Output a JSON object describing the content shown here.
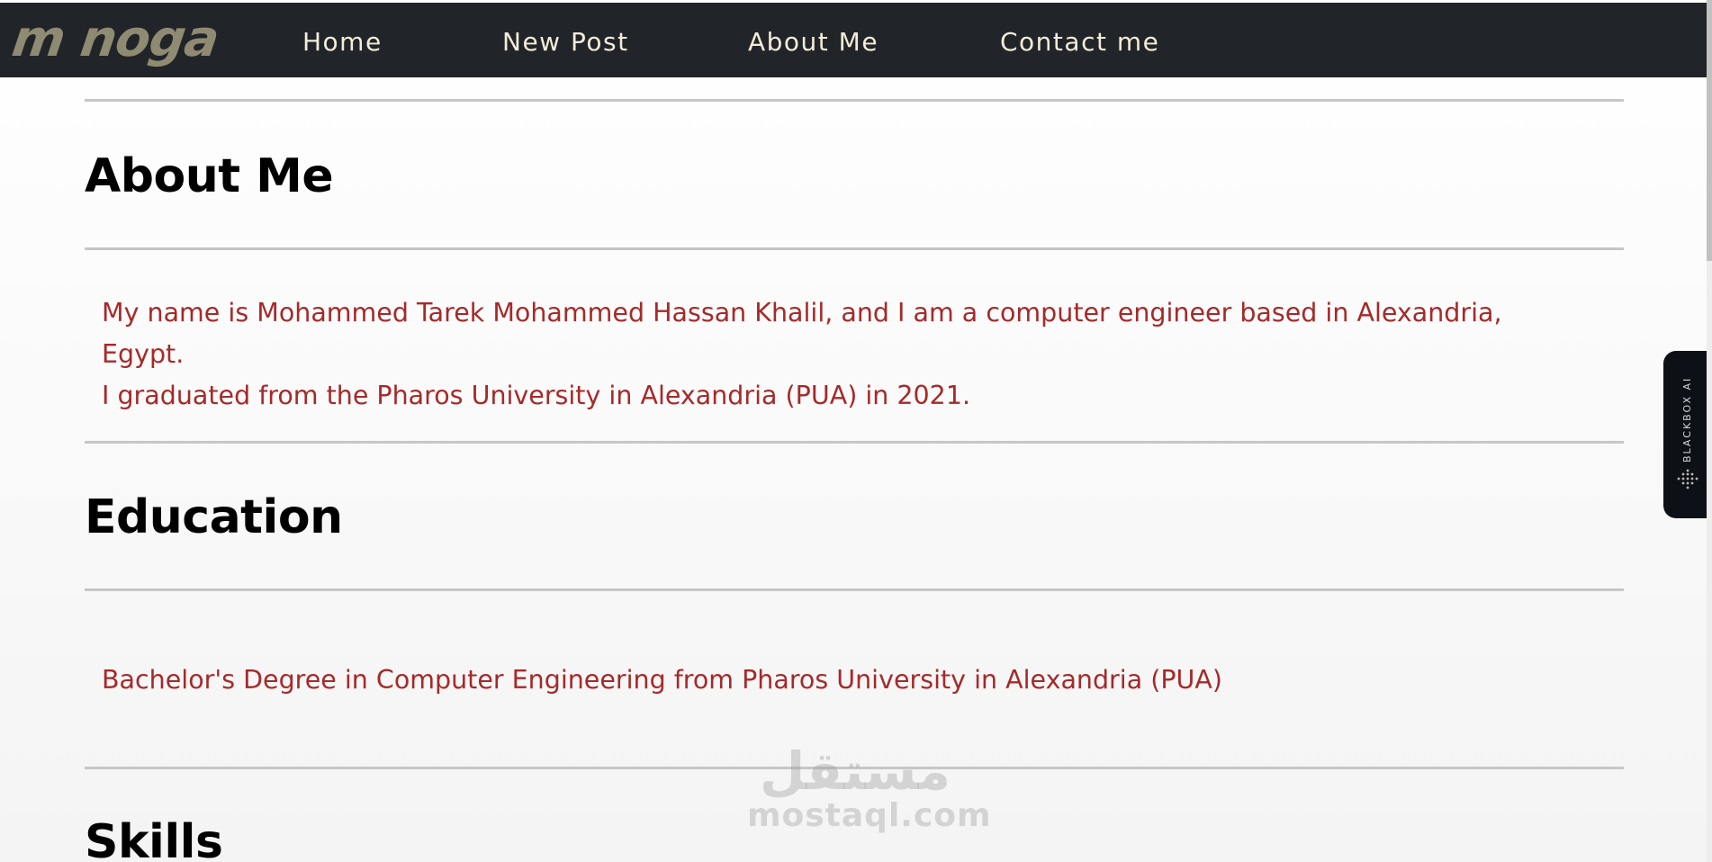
{
  "nav": {
    "logo_text": "m noga",
    "links": [
      "Home",
      "New Post",
      "About Me",
      "Contact me"
    ]
  },
  "about": {
    "heading": "About Me",
    "lines": [
      "My name is Mohammed Tarek Mohammed Hassan Khalil, and I am a computer engineer based in Alexandria, Egypt.",
      "I graduated from the Pharos University in Alexandria (PUA) in 2021."
    ]
  },
  "education": {
    "heading": "Education",
    "text": "Bachelor's Degree in Computer Engineering from Pharos University in Alexandria (PUA)"
  },
  "skills": {
    "heading": "Skills"
  },
  "blackbox": {
    "label": "BLACKBOX AI"
  },
  "watermark": {
    "arabic": "مستقل",
    "latin": "mostaql.com"
  },
  "colors": {
    "navbar_bg": "#212529",
    "nav_text": "#f4ecd8",
    "logo": "#8f8a72",
    "paragraph": "#a52a2a",
    "rule": "#c6c6c6"
  }
}
